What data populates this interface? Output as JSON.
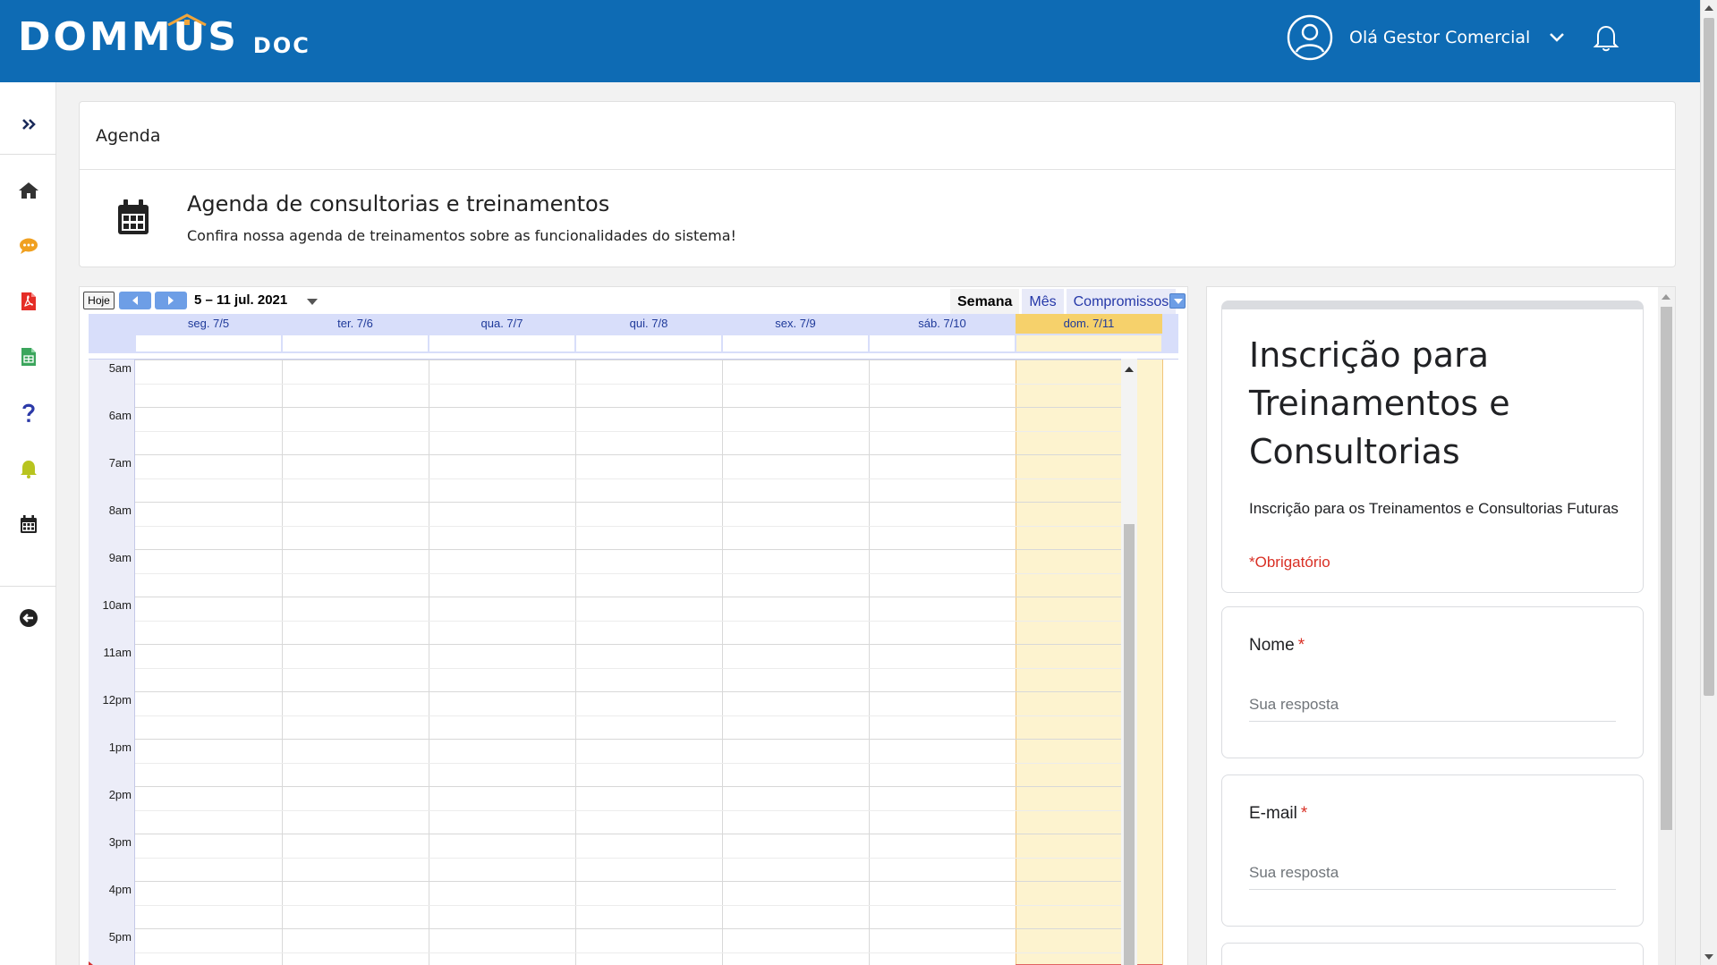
{
  "header": {
    "logo_main": "DOMMUS",
    "logo_sub": "DOC",
    "greeting": "Olá Gestor Comercial",
    "colors": {
      "bar": "#0e6bb4",
      "roof": "#f0a53b"
    }
  },
  "sidebar": {
    "items": [
      {
        "icon": "double-chevron-right-icon"
      },
      {
        "icon": "home-icon"
      },
      {
        "icon": "chat-icon",
        "color": "#f0a020"
      },
      {
        "icon": "pdf-file-icon",
        "color": "#e52d27"
      },
      {
        "icon": "spreadsheet-file-icon",
        "color": "#3ba55c"
      },
      {
        "icon": "question-icon",
        "color": "#2c3aa8"
      },
      {
        "icon": "bell-icon",
        "color": "#b8c41f"
      },
      {
        "icon": "calendar-icon"
      },
      {
        "icon": "logout-arrow-icon"
      }
    ]
  },
  "page": {
    "breadcrumb": "Agenda",
    "title": "Agenda de consultorias e treinamentos",
    "subtitle": "Confira nossa agenda de treinamentos sobre as funcionalidades do sistema!"
  },
  "calendar": {
    "today_button": "Hoje",
    "range": "5 – 11 jul. 2021",
    "tabs": [
      "Semana",
      "Mês",
      "Compromissos"
    ],
    "active_tab": "Semana",
    "days": [
      "seg. 7/5",
      "ter. 7/6",
      "qua. 7/7",
      "qui. 7/8",
      "sex. 7/9",
      "sáb. 7/10",
      "dom. 7/11"
    ],
    "today_index": 6,
    "hours": [
      "5am",
      "6am",
      "7am",
      "8am",
      "9am",
      "10am",
      "11am",
      "12pm",
      "1pm",
      "2pm",
      "3pm",
      "4pm",
      "5pm"
    ]
  },
  "form": {
    "title": "Inscrição para Treinamentos e Consultorias",
    "description": "Inscrição para os Treinamentos e Consultorias Futuras",
    "required_note": "*Obrigatório",
    "questions": [
      {
        "label": "Nome",
        "required_mark": "*",
        "placeholder": "Sua resposta"
      },
      {
        "label": "E-mail",
        "required_mark": "*",
        "placeholder": "Sua resposta"
      }
    ]
  }
}
